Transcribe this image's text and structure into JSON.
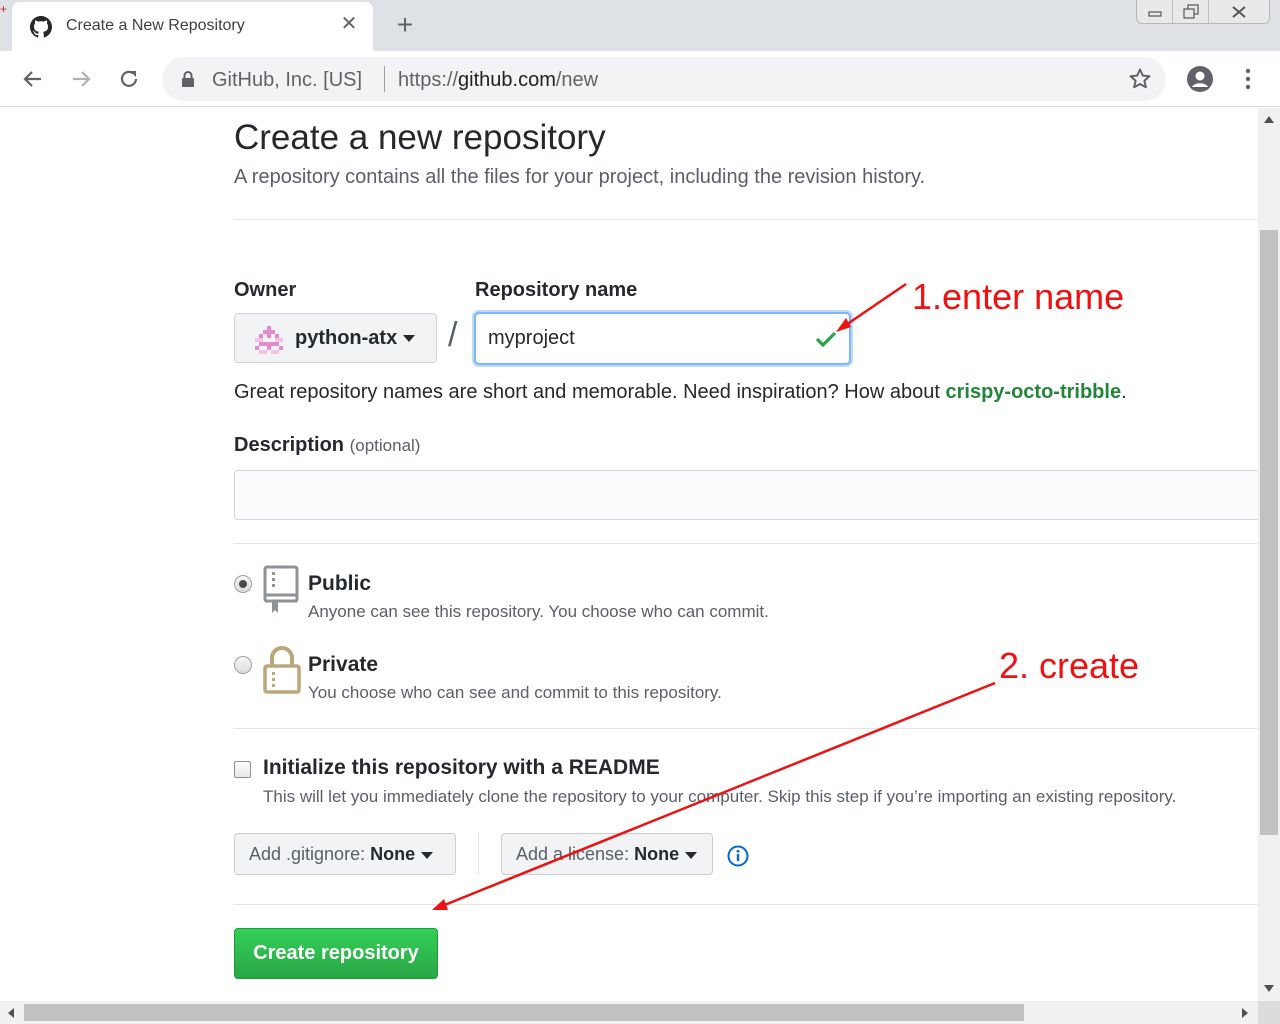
{
  "browser": {
    "tab_title": "Create a New Repository",
    "tab_close": "✕",
    "new_tab": "+",
    "site_identity": "GitHub, Inc. [US]",
    "url_scheme": "https://",
    "url_host": "github.com",
    "url_path": "/new"
  },
  "page": {
    "title": "Create a new repository",
    "subtitle": "A repository contains all the files for your project, including the revision history.",
    "owner_label": "Owner",
    "owner_value": "python-atx",
    "slash": "/",
    "repo_name_label": "Repository name",
    "repo_name_value": "myproject",
    "hint_prefix": "Great repository names are short and memorable. Need inspiration? How about ",
    "hint_suggestion": "crispy-octo-tribble",
    "hint_suffix": ".",
    "description_label": "Description",
    "description_optional": "(optional)",
    "description_value": "",
    "visibility": [
      {
        "title": "Public",
        "desc": "Anyone can see this repository. You choose who can commit.",
        "checked": true
      },
      {
        "title": "Private",
        "desc": "You choose who can see and commit to this repository.",
        "checked": false
      }
    ],
    "init_title": "Initialize this repository with a README",
    "init_desc": "This will let you immediately clone the repository to your computer. Skip this step if you’re importing an existing repository.",
    "gitignore_label": "Add .gitignore: ",
    "gitignore_value": "None",
    "license_label": "Add a license: ",
    "license_value": "None",
    "create_button": "Create repository"
  },
  "annotations": {
    "step1": "1.enter name",
    "step2": "2. create"
  },
  "colors": {
    "accent_green": "#28a745",
    "suggestion_green": "#22863a",
    "annotation_red": "#ee1111",
    "focus_blue": "#79b8ff"
  }
}
